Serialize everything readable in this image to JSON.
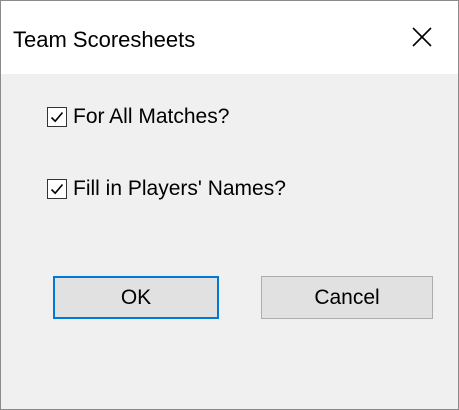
{
  "window": {
    "title": "Team Scoresheets",
    "close_glyph": "×"
  },
  "options": [
    {
      "label": "For All Matches?",
      "checked": true
    },
    {
      "label": "Fill in Players' Names?",
      "checked": true
    }
  ],
  "buttons": {
    "ok_label": "OK",
    "cancel_label": "Cancel"
  },
  "colors": {
    "focus_border": "#0078d7",
    "button_face": "#e1e1e1",
    "client_background": "#f0f0f0"
  }
}
